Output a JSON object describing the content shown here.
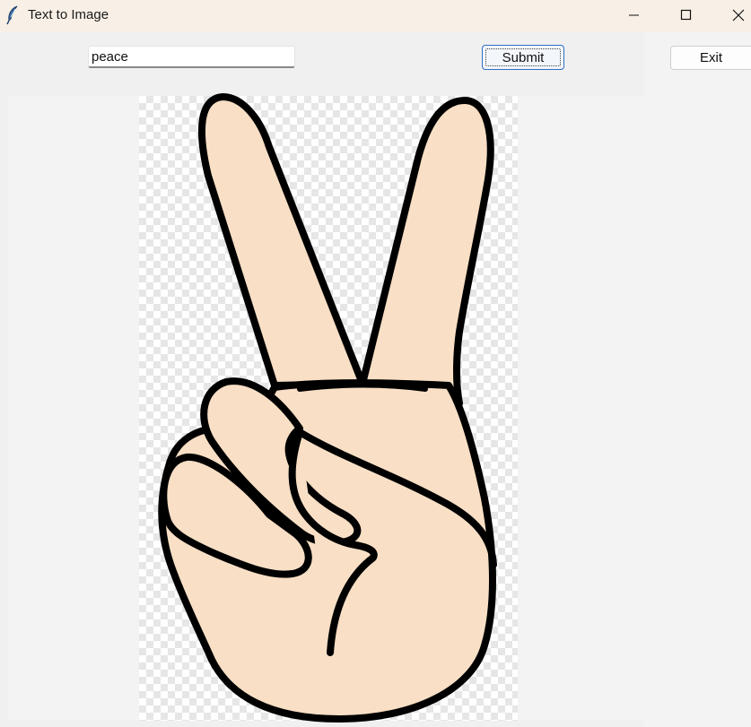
{
  "window": {
    "title": "Text to Image",
    "icon": "feather-icon",
    "controls": [
      "minimize-icon",
      "maximize-icon",
      "close-icon"
    ]
  },
  "prompt": {
    "value": "peace"
  },
  "buttons": {
    "submit_label": "Submit",
    "exit_label": "Exit"
  },
  "generated_image": {
    "subject": "hand-peace-sign",
    "transparent_background": true,
    "colors": {
      "skin": "#f8dfc5",
      "outline": "#000000"
    }
  }
}
